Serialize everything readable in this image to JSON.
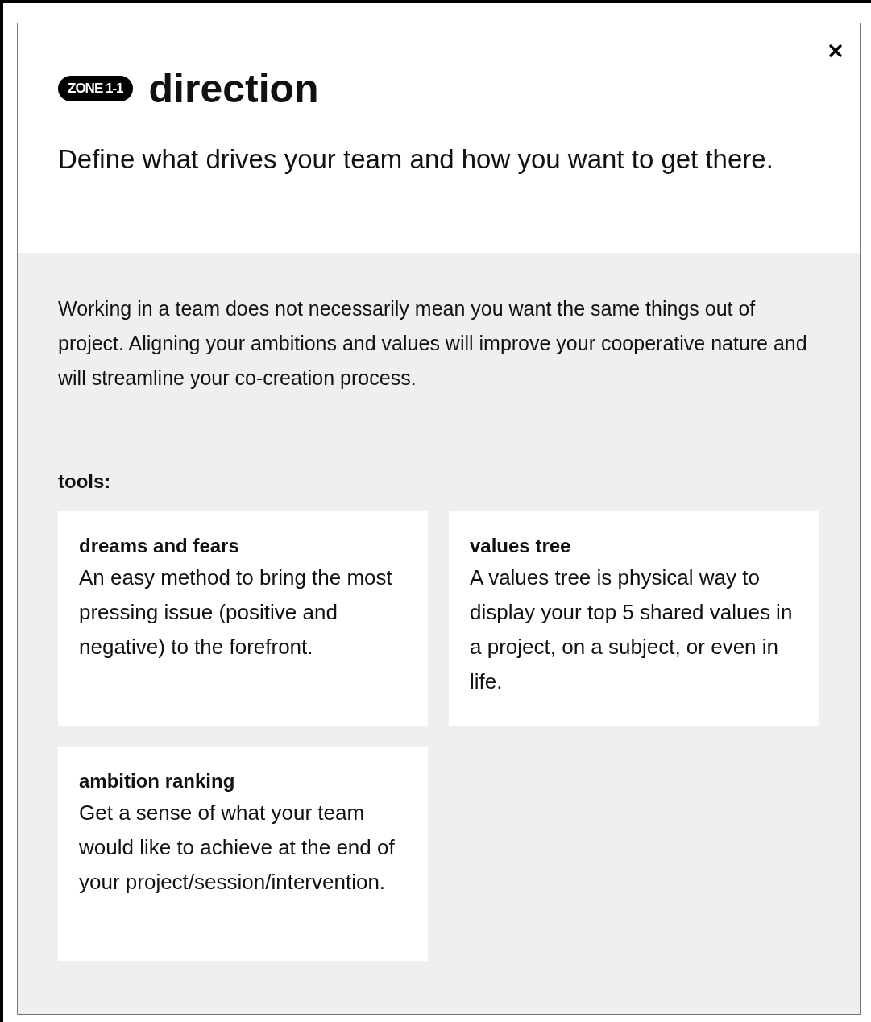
{
  "dialog": {
    "badge": "ZONE 1-1",
    "title": "direction",
    "subtitle": "Define what drives your team and how you want to get there."
  },
  "intro": "Working in a team does not necessarily mean you want the same things out of project. Aligning your ambitions and values will improve your cooperative nature and will streamline your co-creation process.",
  "tools_heading": "tools:",
  "tools": [
    {
      "title": "dreams and fears",
      "description": "An easy method to bring the most pressing issue (positive and negative) to the forefront."
    },
    {
      "title": "values tree",
      "description": "A values tree is physical way to display your top 5 shared values in a project, on a subject, or even in life."
    },
    {
      "title": "ambition ranking",
      "description": "Get a sense of what your team would like to achieve at the end of your project/session/intervention."
    }
  ]
}
